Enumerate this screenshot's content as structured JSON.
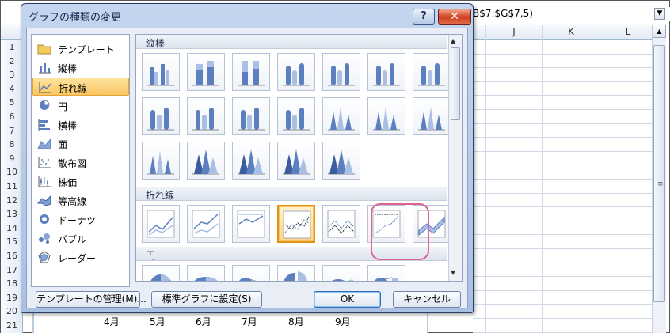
{
  "spreadsheet": {
    "formula_text": "B$7:$G$7,5)",
    "columns": [
      "J",
      "K",
      "L"
    ],
    "rows": [
      "1",
      "2",
      "3",
      "4",
      "5",
      "6",
      "7",
      "8",
      "9",
      "10",
      "11",
      "12",
      "13",
      "14",
      "15",
      "16",
      "17",
      "18",
      "19",
      "20",
      "21"
    ],
    "months": [
      "4月",
      "5月",
      "6月",
      "7月",
      "8月",
      "9月"
    ]
  },
  "dialog": {
    "title": "グラフの種類の変更",
    "help_label": "?",
    "close_label": "✕",
    "categories": [
      {
        "label": "テンプレート",
        "icon": "folder-icon"
      },
      {
        "label": "縦棒",
        "icon": "column-chart-icon"
      },
      {
        "label": "折れ線",
        "icon": "line-chart-icon",
        "selected": true
      },
      {
        "label": "円",
        "icon": "pie-chart-icon"
      },
      {
        "label": "横棒",
        "icon": "bar-chart-icon"
      },
      {
        "label": "面",
        "icon": "area-chart-icon"
      },
      {
        "label": "散布図",
        "icon": "scatter-chart-icon"
      },
      {
        "label": "株価",
        "icon": "stock-chart-icon"
      },
      {
        "label": "等高線",
        "icon": "surface-chart-icon"
      },
      {
        "label": "ドーナツ",
        "icon": "doughnut-chart-icon"
      },
      {
        "label": "バブル",
        "icon": "bubble-chart-icon"
      },
      {
        "label": "レーダー",
        "icon": "radar-chart-icon"
      }
    ],
    "gallery": {
      "groups": [
        {
          "label": "縦棒"
        },
        {
          "label": "折れ線"
        },
        {
          "label": "円"
        }
      ]
    },
    "buttons": {
      "manage_templates": "テンプレートの管理(M)...",
      "set_default": "標準グラフに設定(S)",
      "ok": "OK",
      "cancel": "キャンセル"
    },
    "colors": {
      "selected_fill": "#fbc660",
      "highlight_ring": "#e06090",
      "chart_blue": "#5b7fbf"
    }
  }
}
